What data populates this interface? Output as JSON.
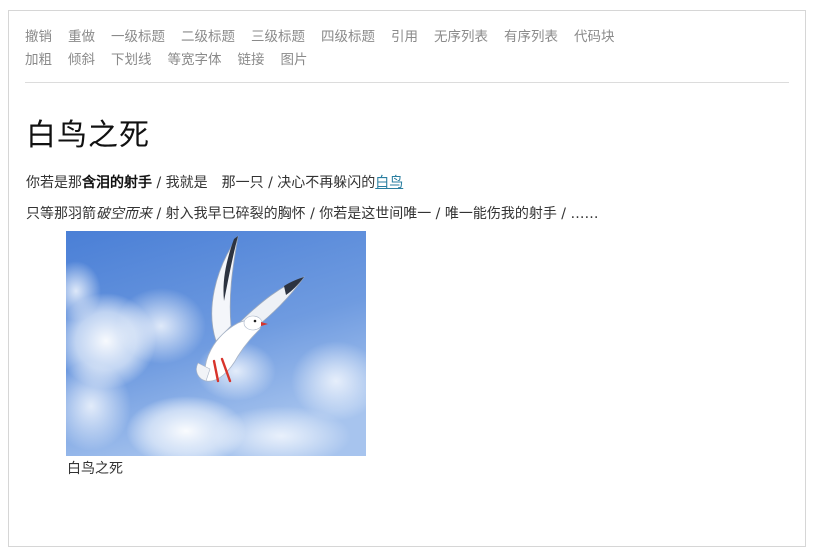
{
  "toolbar": {
    "row1": [
      "撤销",
      "重做",
      "一级标题",
      "二级标题",
      "三级标题",
      "四级标题",
      "引用",
      "无序列表",
      "有序列表",
      "代码块"
    ],
    "row2": [
      "加粗",
      "倾斜",
      "下划线",
      "等宽字体",
      "链接",
      "图片"
    ]
  },
  "document": {
    "title": "白鸟之死",
    "para1": {
      "t1": "你若是那",
      "bold": "含泪的射手",
      "t2": " / 我就是　那一只 / 决心不再躲闪的",
      "link": "白鸟"
    },
    "para2": {
      "t1": "只等那羽箭",
      "italic": "破空而来",
      "t2": " / 射入我早已碎裂的胸怀 / 你若是这世间唯一 / 唯一能伤我的射手 / ……"
    },
    "figure": {
      "caption": "白鸟之死"
    }
  },
  "colors": {
    "toolbar_text": "#8a8a8a",
    "link": "#2a7ea0",
    "sky_top": "#4f86d8",
    "sky_bottom": "#9fc0ee"
  }
}
